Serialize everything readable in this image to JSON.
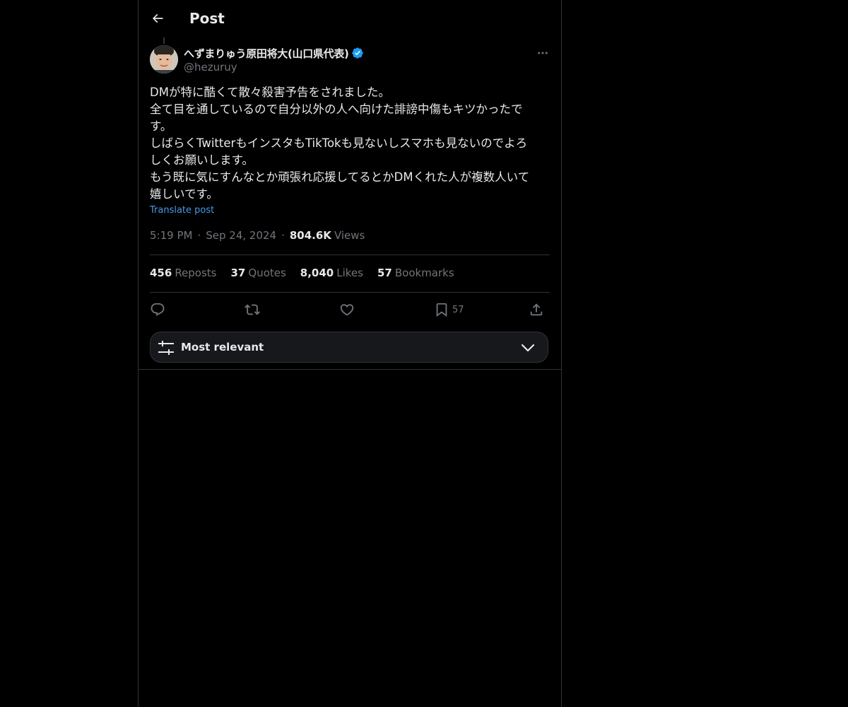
{
  "header": {
    "title": "Post",
    "back_icon": "arrow-left-icon"
  },
  "author": {
    "display_name": "へずまりゅう原田将大(山口県代表)",
    "handle": "@hezuruy",
    "verified": true,
    "verified_color": "#1d9bf0"
  },
  "post": {
    "lines": [
      "DMが特に酷くて散々殺害予告をされました。",
      "全て目を通しているので自分以外の人へ向けた誹謗中傷もキツかったで",
      "す。",
      "しばらくTwitterもインスタもTikTokも見ないしスマホも見ないのでよろ",
      "しくお願いします。",
      "もう既に気にすんなとか頑張れ応援してるとかDMくれた人が複数人いて",
      "嬉しいです。"
    ],
    "translate_label": "Translate post",
    "time": "5:19 PM",
    "date": "Sep 24, 2024",
    "views_count": "804.6K",
    "views_label": "Views",
    "separator": "·"
  },
  "stats": [
    {
      "count": "456",
      "label": "Reposts"
    },
    {
      "count": "37",
      "label": "Quotes"
    },
    {
      "count": "8,040",
      "label": "Likes"
    },
    {
      "count": "57",
      "label": "Bookmarks"
    }
  ],
  "actions": {
    "reply_icon": "reply-icon",
    "repost_icon": "repost-icon",
    "like_icon": "heart-icon",
    "bookmark_icon": "bookmark-icon",
    "bookmark_count": "57",
    "share_icon": "share-icon"
  },
  "sort": {
    "label": "Most relevant",
    "icon": "sliders-icon",
    "chevron": "chevron-down-icon"
  },
  "colors": {
    "background": "#000000",
    "text": "#e7e9ea",
    "muted": "#71767b",
    "link": "#4a99e9",
    "border": "#2f3336"
  }
}
